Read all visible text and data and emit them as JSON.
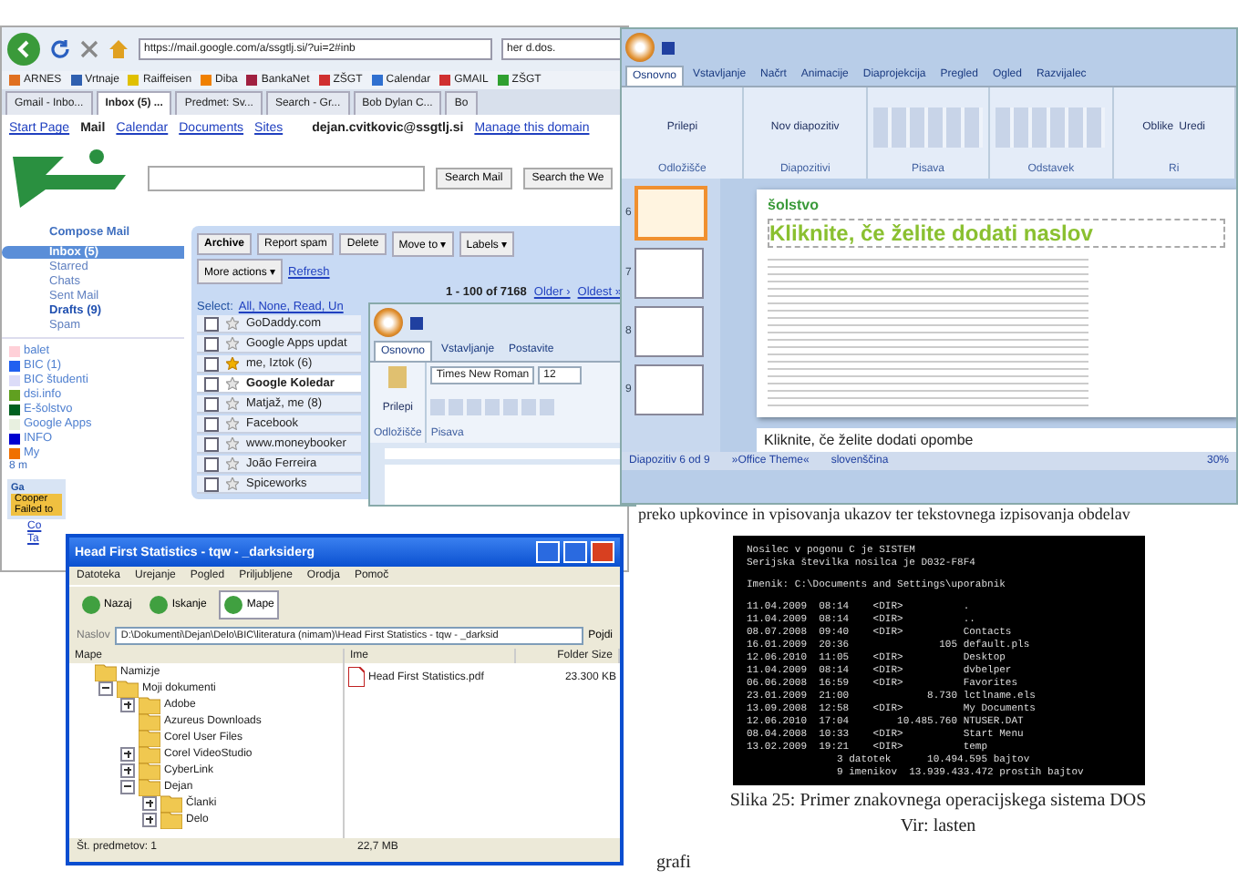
{
  "browser": {
    "address": "https://mail.google.com/a/ssgtlj.si/?ui=2#inb",
    "search": "her d.dos.",
    "bookmarks": [
      {
        "label": "ARNES",
        "color": "#e07020"
      },
      {
        "label": "Vrtnaje",
        "color": "#3060b0"
      },
      {
        "label": "Raiffeisen",
        "color": "#e0c000"
      },
      {
        "label": "Diba",
        "color": "#f08000"
      },
      {
        "label": "BankaNet",
        "color": "#a02040"
      },
      {
        "label": "ZŠGT",
        "color": "#d03030"
      },
      {
        "label": "Calendar",
        "color": "#3070d0"
      },
      {
        "label": "GMAIL",
        "color": "#d03030"
      },
      {
        "label": "ZŠGT",
        "color": "#30a030"
      }
    ],
    "tabs": [
      {
        "label": "Gmail - Inbo...",
        "selected": false
      },
      {
        "label": "Inbox (5) ...",
        "selected": true
      },
      {
        "label": "Predmet: Sv...",
        "selected": false
      },
      {
        "label": "Search - Gr...",
        "selected": false
      },
      {
        "label": "Bob Dylan C...",
        "selected": false
      },
      {
        "label": "Bo",
        "selected": false
      }
    ]
  },
  "gmail": {
    "nav": [
      {
        "label": "Start Page",
        "kind": "link"
      },
      {
        "label": "Mail",
        "kind": "bold"
      },
      {
        "label": "Calendar",
        "kind": "link"
      },
      {
        "label": "Documents",
        "kind": "link"
      },
      {
        "label": "Sites",
        "kind": "link"
      }
    ],
    "user": "dejan.cvitkovic@ssgtlj.si",
    "manage": "Manage this domain",
    "search_buttons": [
      "Search Mail",
      "Search the We"
    ],
    "compose": "Compose Mail",
    "folders": [
      {
        "label": "Inbox (5)",
        "selected": true,
        "bold": true
      },
      {
        "label": "Starred",
        "selected": false,
        "bold": false
      },
      {
        "label": "Chats",
        "selected": false,
        "bold": false
      },
      {
        "label": "Sent Mail",
        "selected": false,
        "bold": false
      },
      {
        "label": "Drafts (9)",
        "selected": false,
        "bold": true
      },
      {
        "label": "Spam",
        "selected": false,
        "bold": false
      }
    ],
    "labels": [
      {
        "label": "balet",
        "color": "#ffd0d8"
      },
      {
        "label": "BIC (1)",
        "color": "#2060f0"
      },
      {
        "label": "BIC študenti",
        "color": "#dcdcf8"
      },
      {
        "label": "dsi.info",
        "color": "#60a020"
      },
      {
        "label": "E-šolstvo",
        "color": "#006020"
      },
      {
        "label": "Google Apps",
        "color": "#e8f0e0"
      },
      {
        "label": "INFO",
        "color": "#0000d0"
      },
      {
        "label": "My",
        "color": "#f07000"
      }
    ],
    "more_labels": "8 m",
    "gadget_title": "Ga",
    "gadget_text": [
      "Cooper",
      "Failed to"
    ],
    "bottom_links": [
      "Co",
      "Ta"
    ],
    "actions": [
      "Archive",
      "Report spam",
      "Delete",
      "Move to ▾",
      "Labels ▾"
    ],
    "more_actions": "More actions ▾",
    "refresh": "Refresh",
    "paging": "1 - 100 of 7168",
    "older": "Older ›",
    "oldest": "Oldest »",
    "select": "Select:",
    "select_links": "All, None, Read, Un",
    "rows": [
      {
        "sender": "GoDaddy.com",
        "starred": false,
        "unread": false
      },
      {
        "sender": "Google Apps updat",
        "starred": false,
        "unread": false
      },
      {
        "sender": "me, Iztok (6)",
        "starred": true,
        "unread": false
      },
      {
        "sender": "Google Koledar",
        "starred": false,
        "unread": true
      },
      {
        "sender": "Matjaž, me (8)",
        "starred": false,
        "unread": false
      },
      {
        "sender": "Facebook",
        "starred": false,
        "unread": false
      },
      {
        "sender": "www.moneybooker",
        "starred": false,
        "unread": false
      },
      {
        "sender": "João Ferreira",
        "starred": false,
        "unread": false
      },
      {
        "sender": "Spiceworks",
        "starred": false,
        "unread": false
      }
    ]
  },
  "word": {
    "tabs": [
      {
        "label": "Osnovno",
        "selected": true
      },
      {
        "label": "Vstavljanje",
        "selected": false
      },
      {
        "label": "Postavite",
        "selected": false
      }
    ],
    "paste": "Prilepi",
    "clipboard": "Odložišče",
    "font": "Times New Roman",
    "size": "12",
    "font_group": "Pisava"
  },
  "powerpoint": {
    "tabs": [
      {
        "label": "Osnovno",
        "selected": true
      },
      {
        "label": "Vstavljanje",
        "selected": false
      },
      {
        "label": "Načrt",
        "selected": false
      },
      {
        "label": "Animacije",
        "selected": false
      },
      {
        "label": "Diaprojekcija",
        "selected": false
      },
      {
        "label": "Pregled",
        "selected": false
      },
      {
        "label": "Ogled",
        "selected": false
      },
      {
        "label": "Razvijalec",
        "selected": false
      }
    ],
    "groups": [
      {
        "label": "Odložišče",
        "buttons": [
          "Prilepi"
        ]
      },
      {
        "label": "Diapozitivi",
        "buttons": [
          "Nov diapozitiv"
        ]
      },
      {
        "label": "Pisava"
      },
      {
        "label": "Odstavek"
      },
      {
        "label": "Ri",
        "buttons": [
          "Oblike",
          "Uredi"
        ]
      }
    ],
    "thumbs": [
      {
        "number": "6",
        "selected": true
      },
      {
        "number": "7",
        "selected": false
      },
      {
        "number": "8",
        "selected": false
      },
      {
        "number": "9",
        "selected": false
      }
    ],
    "slide_logo": "šolstvo",
    "slide_title": "Kliknite, če želite dodati naslov",
    "notes": "Kliknite, če želite dodati opombe",
    "status": [
      "Diapozitiv 6 od 9",
      "»Office Theme«",
      "slovenščina"
    ],
    "zoom": "30%"
  },
  "explorer": {
    "title": "Head First Statistics - tqw - _darksiderg",
    "menu": [
      "Datoteka",
      "Urejanje",
      "Pogled",
      "Priljubljene",
      "Orodja",
      "Pomoč"
    ],
    "toolbar": [
      {
        "label": "Nazaj",
        "selected": false
      },
      {
        "label": "Iskanje",
        "selected": false
      },
      {
        "label": "Mape",
        "selected": true
      }
    ],
    "address_label": "Naslov",
    "address": "D:\\Dokumenti\\Dejan\\Delo\\BIC\\literatura (nimam)\\Head First Statistics - tqw - _darksid",
    "go": "Pojdi",
    "pane": "Mape",
    "tree": [
      {
        "label": "Namizje",
        "children": [
          {
            "label": "Moji dokumenti",
            "expanded": true,
            "children": [
              {
                "label": "Adobe",
                "expanded": false
              },
              {
                "label": "Azureus Downloads"
              },
              {
                "label": "Corel User Files"
              },
              {
                "label": "Corel VideoStudio",
                "expanded": false
              },
              {
                "label": "CyberLink",
                "expanded": false
              },
              {
                "label": "Dejan",
                "expanded": true,
                "children": [
                  {
                    "label": "Članki",
                    "expanded": false
                  },
                  {
                    "label": "Delo",
                    "expanded": false
                  }
                ]
              }
            ]
          }
        ]
      }
    ],
    "columns": [
      "Ime",
      "Folder Size"
    ],
    "files": [
      {
        "name": "Head First Statistics.pdf",
        "size": "23.300 KB"
      }
    ],
    "status": [
      "Št. predmetov: 1",
      "22,7 MB"
    ]
  },
  "document": {
    "line": "preko upkovince in vpisovanja ukazov ter tekstovnega izpisovanja obdelav",
    "console_header": [
      "Nosilec v pogonu C je SISTEM",
      "Serijska številka nosilca je D032-F8F4"
    ],
    "console_path": "Imenik: C:\\Documents and Settings\\uporabnik",
    "console": [
      "11.04.2009  08:14    <DIR>          .",
      "11.04.2009  08:14    <DIR>          ..",
      "08.07.2008  09:40    <DIR>          Contacts",
      "16.01.2009  20:36               105 default.pls",
      "12.06.2010  11:05    <DIR>          Desktop",
      "11.04.2009  08:14    <DIR>          dvbelper",
      "06.06.2008  16:59    <DIR>          Favorites",
      "23.01.2009  21:00             8.730 lctlname.els",
      "13.09.2008  12:58    <DIR>          My Documents",
      "12.06.2010  17:04        10.485.760 NTUSER.DAT",
      "08.04.2008  10:33    <DIR>          Start Menu",
      "13.02.2009  19:21    <DIR>          temp",
      "               3 datotek      10.494.595 bajtov",
      "               9 imenikov  13.939.433.472 prostih bajtov"
    ],
    "caption": "Slika 25: Primer znakovnega operacijskega sistema DOS",
    "source": "Vir: lasten",
    "bottom": "grafi"
  }
}
